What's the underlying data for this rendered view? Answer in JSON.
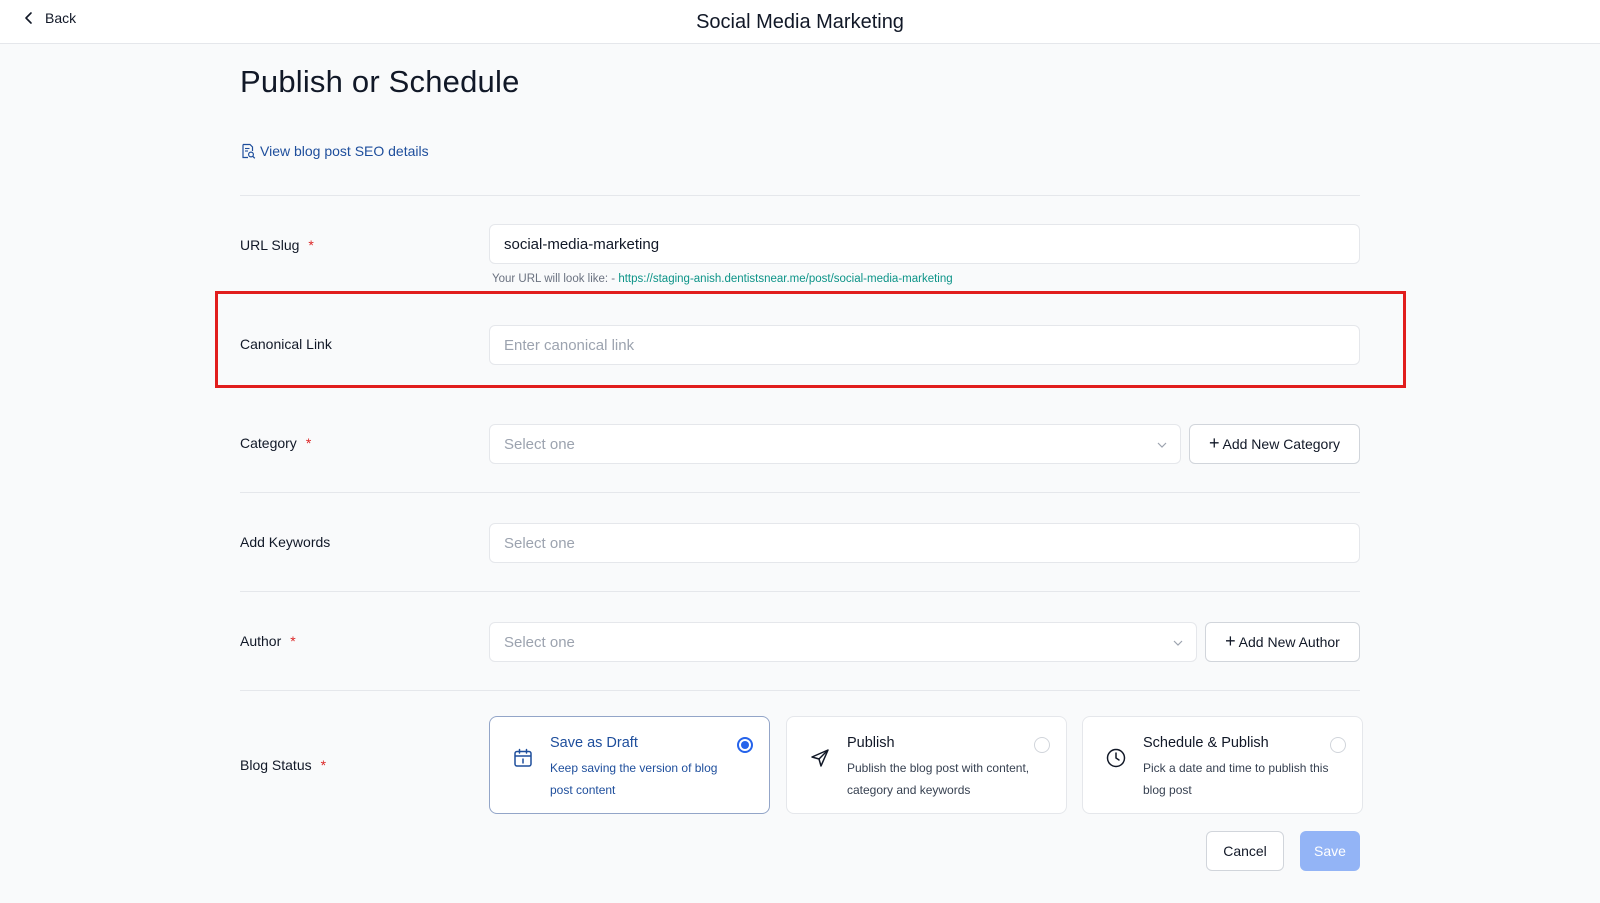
{
  "header": {
    "back_label": "Back",
    "app_title": "Social Media Marketing"
  },
  "page": {
    "title": "Publish or Schedule",
    "seo_link_label": "View blog post SEO details"
  },
  "form": {
    "url_slug": {
      "label": "URL Slug",
      "required_mark": "*",
      "value": "social-media-marketing",
      "hint_prefix": "Your URL will look like: - ",
      "hint_url": "https://staging-anish.dentistsnear.me/post/social-media-marketing"
    },
    "canonical_link": {
      "label": "Canonical Link",
      "placeholder": "Enter canonical link"
    },
    "category": {
      "label": "Category",
      "required_mark": "*",
      "placeholder": "Select one",
      "add_button": "Add New Category"
    },
    "keywords": {
      "label": "Add Keywords",
      "placeholder": "Select one"
    },
    "author": {
      "label": "Author",
      "required_mark": "*",
      "placeholder": "Select one",
      "add_button": "Add New Author"
    },
    "blog_status": {
      "label": "Blog Status",
      "required_mark": "*",
      "options": [
        {
          "title": "Save as Draft",
          "description": "Keep saving the version of blog post content",
          "icon": "calendar-icon",
          "selected": true
        },
        {
          "title": "Publish",
          "description": "Publish the blog post with content, category and keywords",
          "icon": "send-icon",
          "selected": false
        },
        {
          "title": "Schedule & Publish",
          "description": "Pick a date and time to publish this blog post",
          "icon": "clock-icon",
          "selected": false
        }
      ]
    }
  },
  "actions": {
    "cancel_label": "Cancel",
    "save_label": "Save"
  },
  "colors": {
    "accent": "#1e4e9c",
    "required": "#dc2626",
    "highlight_box": "#e11d1d",
    "save_disabled": "#93b4f6",
    "hint_url": "#0d9488"
  }
}
